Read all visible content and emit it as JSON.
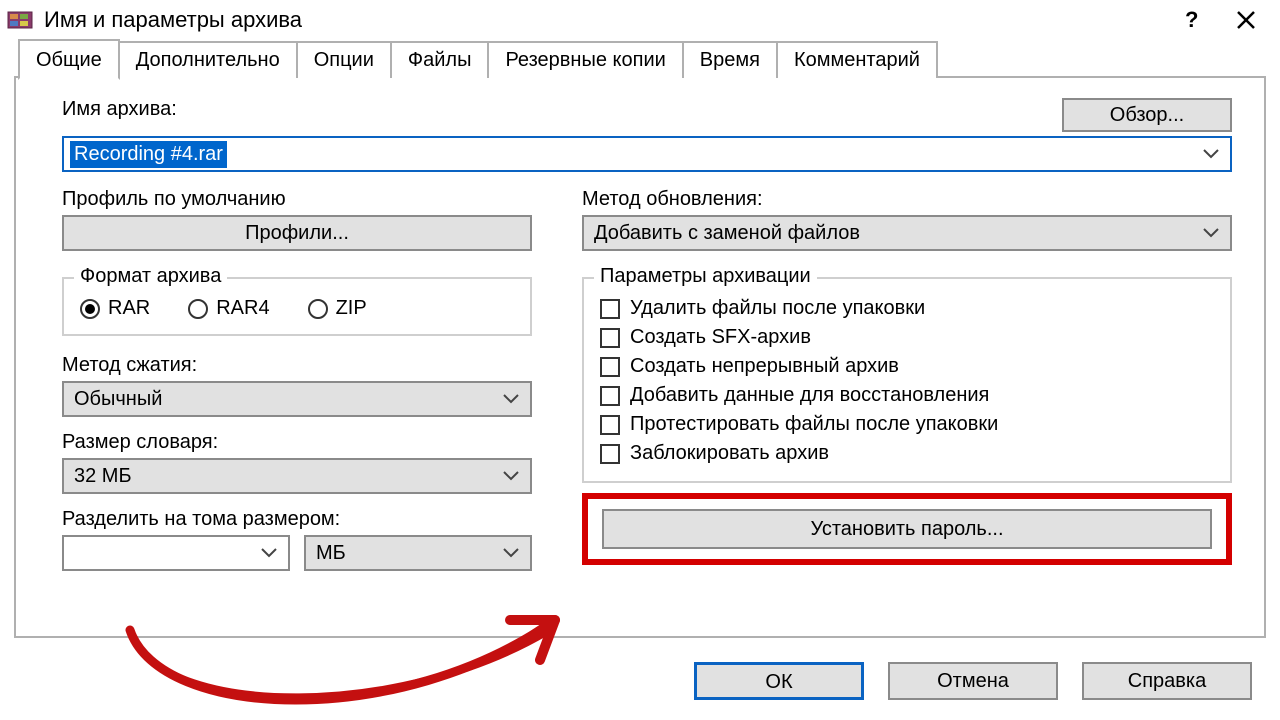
{
  "window": {
    "title": "Имя и параметры архива"
  },
  "tabs": {
    "general": "Общие",
    "advanced": "Дополнительно",
    "options": "Опции",
    "files": "Файлы",
    "backup": "Резервные копии",
    "time": "Время",
    "comment": "Комментарий"
  },
  "labels": {
    "archive_name": "Имя архива:",
    "browse": "Обзор...",
    "default_profile": "Профиль по умолчанию",
    "profiles_btn": "Профили...",
    "update_method": "Метод обновления:",
    "archive_format": "Формат архива",
    "compression_method": "Метод сжатия:",
    "dict_size": "Размер словаря:",
    "split": "Разделить на тома размером:",
    "archiving_params": "Параметры архивации",
    "set_password": "Установить пароль..."
  },
  "values": {
    "archive_name": "Recording #4.rar",
    "update_method": "Добавить с заменой файлов",
    "compression_method": "Обычный",
    "dict_size": "32 МБ",
    "split_size": "",
    "split_unit": "МБ"
  },
  "formats": {
    "rar": "RAR",
    "rar4": "RAR4",
    "zip": "ZIP",
    "selected": "rar"
  },
  "options": {
    "delete_after": "Удалить файлы после упаковки",
    "sfx": "Создать SFX-архив",
    "solid": "Создать непрерывный архив",
    "recovery": "Добавить данные для восстановления",
    "test": "Протестировать файлы после упаковки",
    "lock": "Заблокировать архив"
  },
  "footer": {
    "ok": "ОК",
    "cancel": "Отмена",
    "help": "Справка"
  }
}
